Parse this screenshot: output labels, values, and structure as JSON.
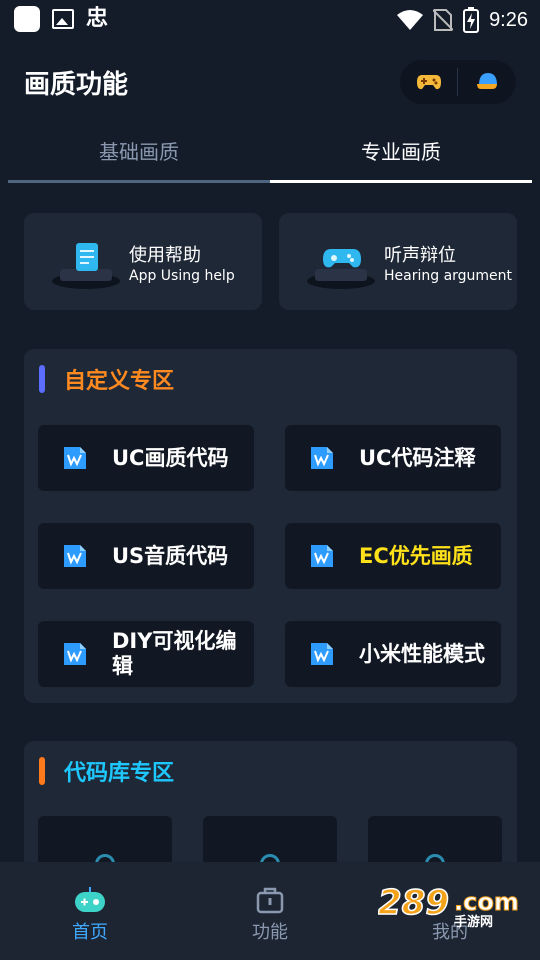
{
  "status_bar": {
    "time": "9:26",
    "notification_glyph": "忠"
  },
  "header": {
    "title": "画质功能"
  },
  "tabs": [
    {
      "label": "基础画质"
    },
    {
      "label": "专业画质"
    }
  ],
  "help_cards": [
    {
      "title": "使用帮助",
      "subtitle": "App Using help",
      "icon": "help-document-icon"
    },
    {
      "title": "听声辩位",
      "subtitle": "Hearing argument",
      "icon": "game-controller-icon"
    }
  ],
  "custom_section": {
    "title": "自定义专区",
    "title_color": "#ff8a1f",
    "bar_color": "#5b6cff",
    "items": [
      {
        "label": "UC画质代码",
        "color": "#ffffff"
      },
      {
        "label": "UC代码注释",
        "color": "#ffffff"
      },
      {
        "label": "US音质代码",
        "color": "#ffffff"
      },
      {
        "label": "EC优先画质",
        "color": "#ffe11a"
      },
      {
        "label": "DIY可视化编辑",
        "color": "#ffffff"
      },
      {
        "label": "小米性能模式",
        "color": "#ffffff"
      }
    ]
  },
  "code_section": {
    "title": "代码库专区",
    "title_color": "#1ec8ff",
    "bar_color": "#ff7a1a"
  },
  "bottom_nav": [
    {
      "label": "首页",
      "active": true
    },
    {
      "label": "功能",
      "active": false
    },
    {
      "label": "我的",
      "active": false
    }
  ],
  "watermark": {
    "text1": "289",
    "text2": ".com",
    "text3": "手游网"
  },
  "colors": {
    "accent_blue": "#3fa9ff",
    "inactive": "#8a99b0",
    "card": "#1f2837",
    "tile": "#121823"
  }
}
